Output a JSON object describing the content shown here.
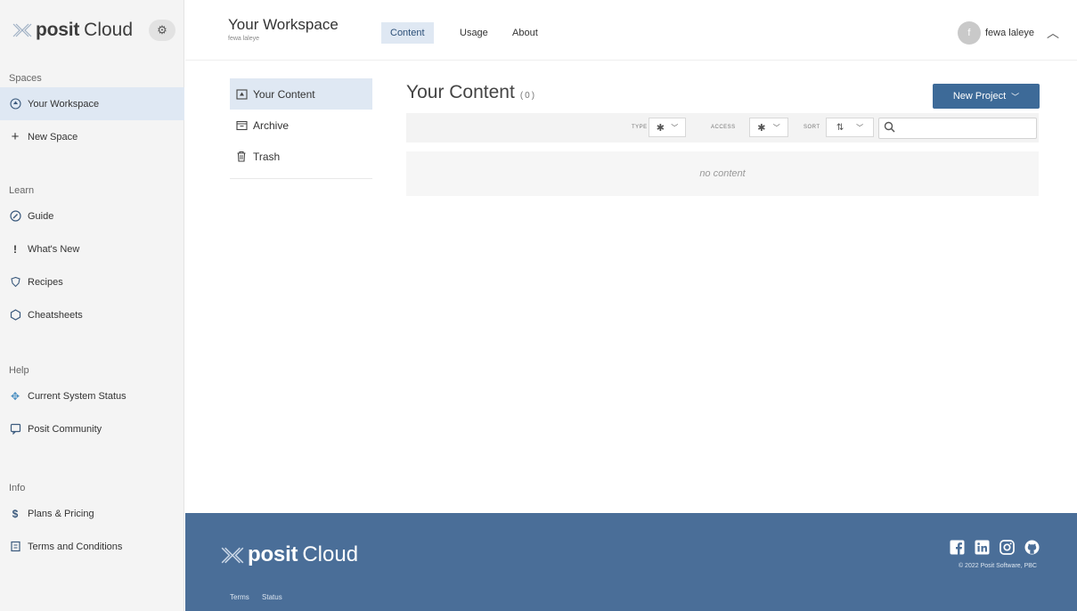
{
  "brand": {
    "posit": "posit",
    "cloud": "Cloud"
  },
  "sidebar": {
    "sections": [
      {
        "heading": "Spaces",
        "items": [
          {
            "label": "Your Workspace",
            "icon": "upload-circle-icon",
            "active": true
          },
          {
            "label": "New Space",
            "icon": "plus-icon"
          }
        ]
      },
      {
        "heading": "Learn",
        "items": [
          {
            "label": "Guide",
            "icon": "compass-icon"
          },
          {
            "label": "What's New",
            "icon": "exclamation-icon"
          },
          {
            "label": "Recipes",
            "icon": "shield-icon"
          },
          {
            "label": "Cheatsheets",
            "icon": "hexagon-icon"
          }
        ]
      },
      {
        "heading": "Help",
        "items": [
          {
            "label": "Current System Status",
            "icon": "status-icon"
          },
          {
            "label": "Posit Community",
            "icon": "chat-icon"
          }
        ]
      },
      {
        "heading": "Info",
        "items": [
          {
            "label": "Plans & Pricing",
            "icon": "dollar-icon"
          },
          {
            "label": "Terms and Conditions",
            "icon": "document-icon"
          }
        ]
      }
    ]
  },
  "header": {
    "title": "Your Workspace",
    "owner": "fewa laleye",
    "tabs": [
      "Content",
      "Usage",
      "About"
    ],
    "user": {
      "initial": "f",
      "name": "fewa laleye"
    }
  },
  "content_nav": {
    "items": [
      {
        "label": "Your Content",
        "icon": "content-icon",
        "active": true
      },
      {
        "label": "Archive",
        "icon": "archive-icon"
      },
      {
        "label": "Trash",
        "icon": "trash-icon"
      }
    ]
  },
  "main": {
    "title": "Your Content",
    "count": "(0)",
    "new_project_label": "New Project",
    "filters": {
      "type_label": "TYPE",
      "access_label": "ACCESS",
      "sort_label": "SORT",
      "type_value": "✱",
      "access_value": "✱"
    },
    "search": {
      "value": "",
      "placeholder": ""
    },
    "empty_text": "no content"
  },
  "footer": {
    "links": [
      "Terms",
      "Status"
    ],
    "copyright": "© 2022 Posit Software, PBC",
    "social_icons": [
      "facebook-icon",
      "linkedin-icon",
      "instagram-icon",
      "github-icon"
    ]
  },
  "colors": {
    "accent": "#3d6a98",
    "footer_bg": "#4a6e98",
    "active_bg": "#dfe8f3",
    "sidebar_bg": "#f4f4f4"
  }
}
